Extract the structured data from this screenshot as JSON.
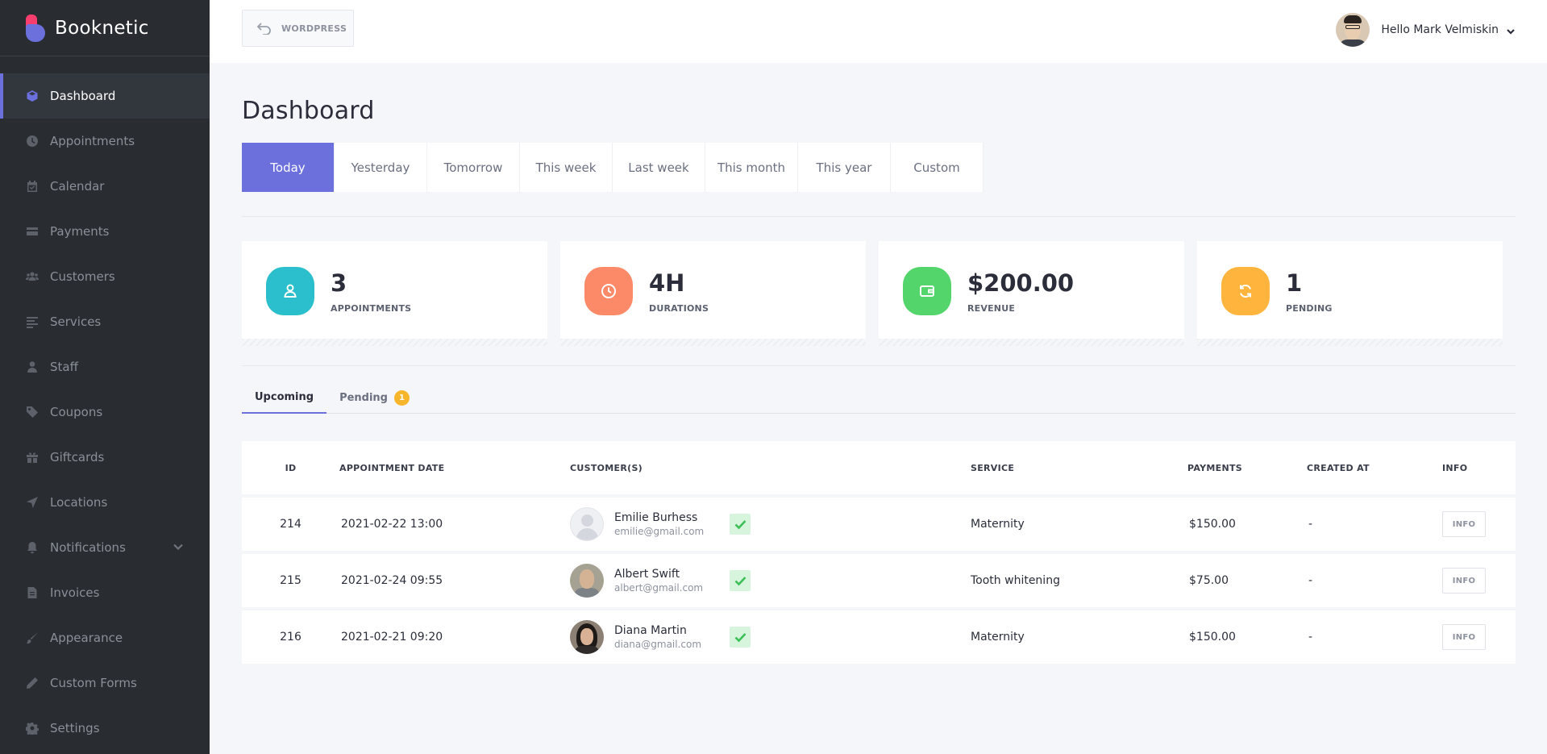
{
  "app": {
    "name": "Booknetic"
  },
  "sidebar": {
    "items": [
      {
        "label": "Dashboard",
        "icon": "cube-icon",
        "active": true
      },
      {
        "label": "Appointments",
        "icon": "clock-icon"
      },
      {
        "label": "Calendar",
        "icon": "calendar-icon"
      },
      {
        "label": "Payments",
        "icon": "credit-card-icon"
      },
      {
        "label": "Customers",
        "icon": "users-icon"
      },
      {
        "label": "Services",
        "icon": "list-icon"
      },
      {
        "label": "Staff",
        "icon": "user-icon"
      },
      {
        "label": "Coupons",
        "icon": "tag-icon"
      },
      {
        "label": "Giftcards",
        "icon": "gift-icon"
      },
      {
        "label": "Locations",
        "icon": "location-arrow-icon"
      },
      {
        "label": "Notifications",
        "icon": "bell-icon",
        "has_submenu": true
      },
      {
        "label": "Invoices",
        "icon": "file-icon"
      },
      {
        "label": "Appearance",
        "icon": "brush-icon"
      },
      {
        "label": "Custom Forms",
        "icon": "pencil-ruler-icon"
      },
      {
        "label": "Settings",
        "icon": "gear-icon"
      }
    ]
  },
  "topbar": {
    "wordpress_label": "WORDPRESS",
    "greeting": "Hello Mark Velmiskin"
  },
  "page": {
    "title": "Dashboard"
  },
  "period_tabs": [
    "Today",
    "Yesterday",
    "Tomorrow",
    "This week",
    "Last week",
    "This month",
    "This year",
    "Custom"
  ],
  "period_active": "Today",
  "stats": [
    {
      "value": "3",
      "label": "APPOINTMENTS",
      "icon": "user-icon",
      "color": "#2bbfcd"
    },
    {
      "value": "4H",
      "label": "DURATIONS",
      "icon": "clock-icon",
      "color": "#fc8a68"
    },
    {
      "value": "$200.00",
      "label": "REVENUE",
      "icon": "wallet-icon",
      "color": "#53d56c"
    },
    {
      "value": "1",
      "label": "PENDING",
      "icon": "refresh-icon",
      "color": "#ffb53d"
    }
  ],
  "sub_tabs": {
    "upcoming": "Upcoming",
    "pending": "Pending",
    "pending_count": "1"
  },
  "table": {
    "headers": {
      "id": "ID",
      "date": "APPOINTMENT DATE",
      "customers": "CUSTOMER(S)",
      "service": "SERVICE",
      "payments": "PAYMENTS",
      "created": "CREATED AT",
      "info": "INFO"
    },
    "rows": [
      {
        "id": "214",
        "date": "2021-02-22 13:00",
        "name": "Emilie Burhess",
        "email": "emilie@gmail.com",
        "service": "Maternity",
        "payment": "$150.00",
        "created": "-",
        "info": "INFO"
      },
      {
        "id": "215",
        "date": "2021-02-24 09:55",
        "name": "Albert Swift",
        "email": "albert@gmail.com",
        "service": "Tooth whitening",
        "payment": "$75.00",
        "created": "-",
        "info": "INFO"
      },
      {
        "id": "216",
        "date": "2021-02-21 09:20",
        "name": "Diana Martin",
        "email": "diana@gmail.com",
        "service": "Maternity",
        "payment": "$150.00",
        "created": "-",
        "info": "INFO"
      }
    ]
  },
  "colors": {
    "accent": "#6c70dc",
    "sidebar_bg": "#292d32",
    "logo_pink": "#fb3e6e",
    "check_green": "#3dbf57",
    "badge_orange": "#f7b52c"
  }
}
